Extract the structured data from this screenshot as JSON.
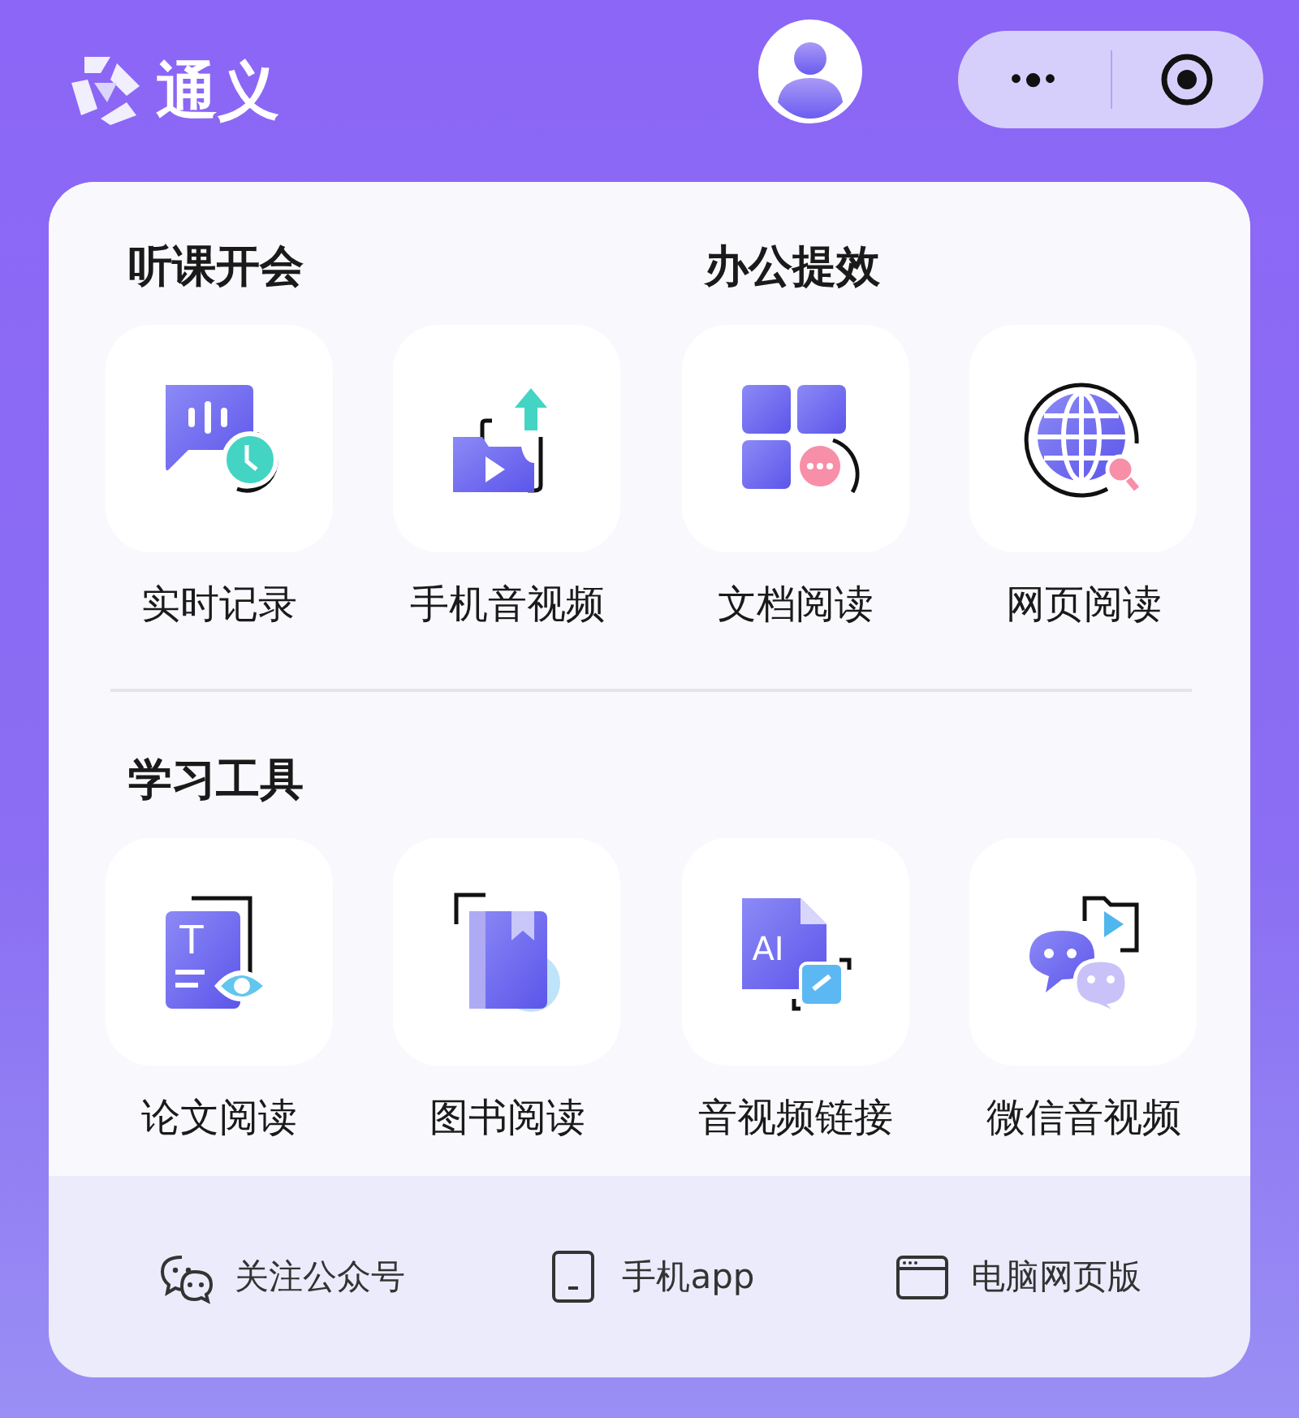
{
  "header": {
    "logo_text": "通义"
  },
  "capsule": {
    "more_icon": "•●•"
  },
  "rows": [
    {
      "groups": [
        {
          "title": "听课开会",
          "items": [
            {
              "label": "实时记录"
            },
            {
              "label": "手机音视频"
            }
          ]
        },
        {
          "title": "办公提效",
          "items": [
            {
              "label": "文档阅读"
            },
            {
              "label": "网页阅读"
            }
          ]
        }
      ]
    },
    {
      "groups": [
        {
          "title": "学习工具",
          "items": [
            {
              "label": "论文阅读",
              "icon_text": "T"
            },
            {
              "label": "图书阅读"
            },
            {
              "label": "音视频链接",
              "icon_text": "AI"
            },
            {
              "label": "微信音视频"
            }
          ]
        }
      ]
    }
  ],
  "footer": [
    {
      "label": "关注公众号"
    },
    {
      "label": "手机app"
    },
    {
      "label": "电脑网页版"
    }
  ]
}
